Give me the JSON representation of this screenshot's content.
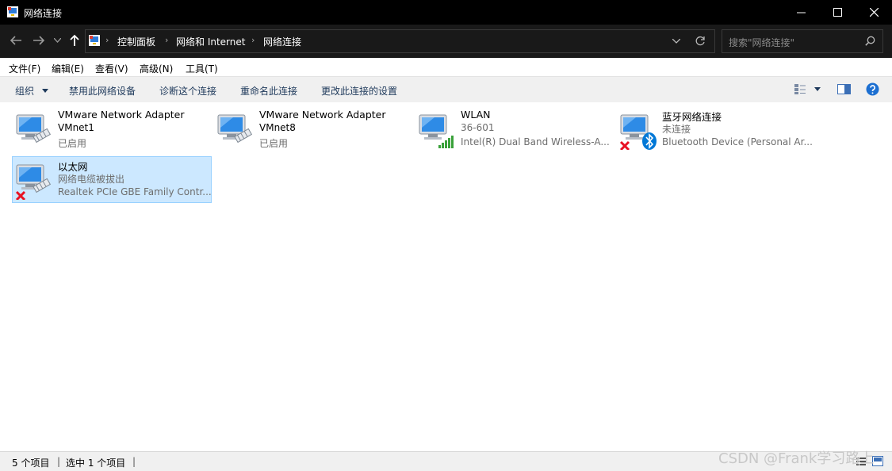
{
  "window": {
    "title": "网络连接"
  },
  "address": {
    "crumbs": [
      "控制面板",
      "网络和 Internet",
      "网络连接"
    ],
    "search_placeholder": "搜索\"网络连接\""
  },
  "menu": [
    "文件(F)",
    "编辑(E)",
    "查看(V)",
    "高级(N)",
    "工具(T)"
  ],
  "commands": {
    "organize": "组织",
    "disable": "禁用此网络设备",
    "diagnose": "诊断这个连接",
    "rename": "重命名此连接",
    "change": "更改此连接的设置"
  },
  "connections": [
    {
      "name": "VMware Network Adapter",
      "line2": "VMnet1",
      "line3": "已启用",
      "type": "ethernet",
      "status": "enabled"
    },
    {
      "name": "VMware Network Adapter",
      "line2": "VMnet8",
      "line3": "已启用",
      "type": "ethernet",
      "status": "enabled"
    },
    {
      "name": "WLAN",
      "line2": "36-601",
      "line3": "Intel(R) Dual Band Wireless-A...",
      "type": "wifi",
      "status": "connected"
    },
    {
      "name": "蓝牙网络连接",
      "line2": "未连接",
      "line3": "Bluetooth Device (Personal Ar...",
      "type": "bluetooth",
      "status": "disconnected"
    },
    {
      "name": "以太网",
      "line2": "网络电缆被拔出",
      "line3": "Realtek PCIe GBE Family Contr...",
      "type": "ethernet",
      "status": "unplugged",
      "selected": true
    }
  ],
  "status": {
    "count": "5 个项目",
    "selected": "选中 1 个项目"
  },
  "watermark": "CSDN @Frank学习路上",
  "colors": {
    "titlebar": "#000000",
    "selection": "#cce8ff",
    "link": "#1e395b",
    "error_x": "#e81123",
    "bluetooth": "#0078d7",
    "wifi_bars": "#3aa13a"
  }
}
